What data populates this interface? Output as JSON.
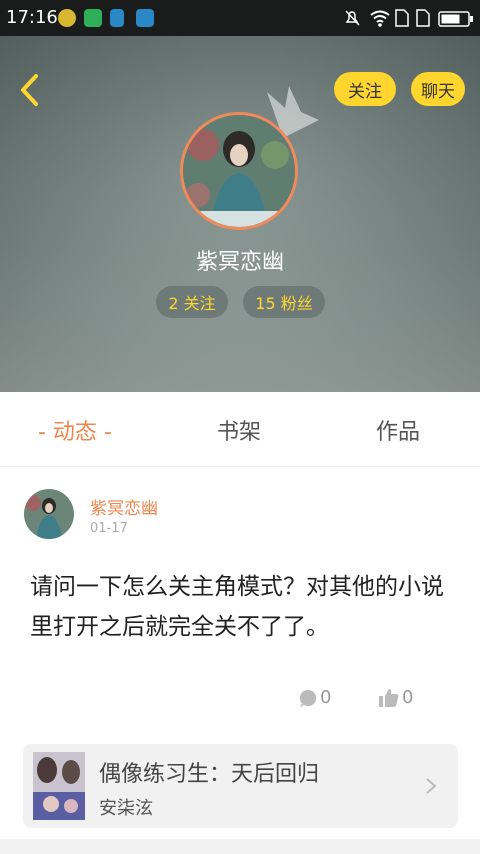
{
  "status_bar": {
    "time": "17:16"
  },
  "header": {
    "follow_label": "关注",
    "chat_label": "聊天"
  },
  "profile": {
    "name": "紫冥恋幽",
    "following": "2 关注",
    "fans": "15 粉丝"
  },
  "tabs": [
    {
      "label": "- 动态 -"
    },
    {
      "label": "书架"
    },
    {
      "label": "作品"
    }
  ],
  "post": {
    "author": "紫冥恋幽",
    "date": "01-17",
    "text": "请问一下怎么关主角模式？对其他的小说里打开之后就完全关不了了。",
    "comments": "0",
    "likes": "0"
  },
  "book": {
    "title": "偶像练习生：天后回归",
    "author": "安柒泫"
  },
  "colors": {
    "accent": "#f0854f",
    "pill": "#ffd52e"
  }
}
